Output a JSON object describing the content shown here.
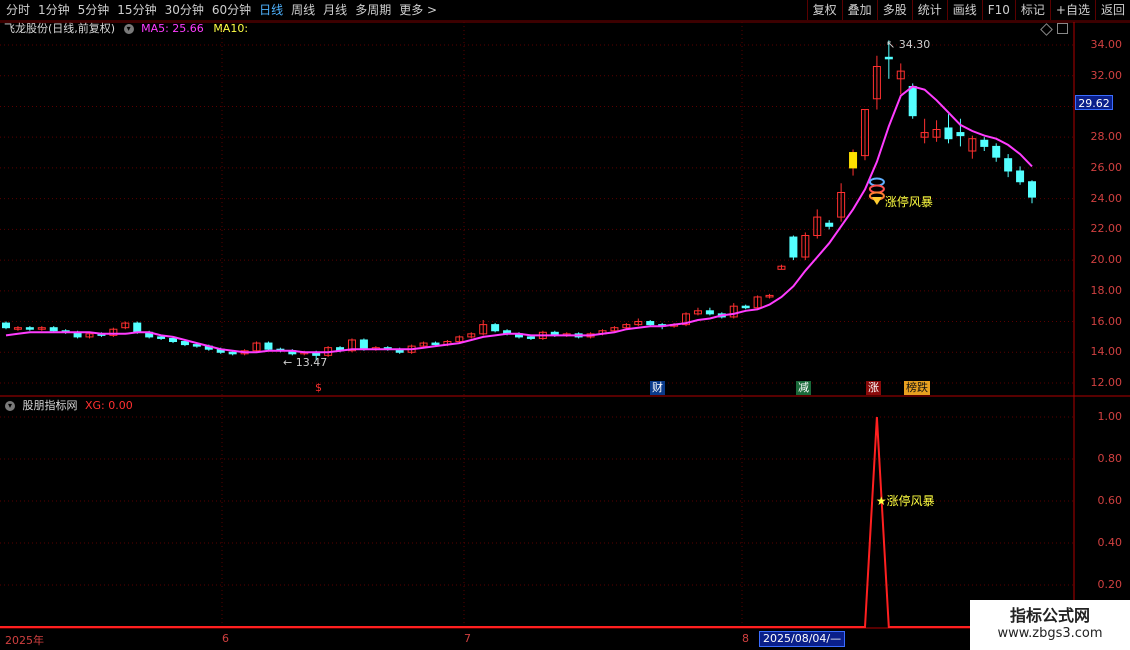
{
  "toolbar": {
    "periods": [
      "分时",
      "1分钟",
      "5分钟",
      "15分钟",
      "30分钟",
      "60分钟",
      "日线",
      "周线",
      "月线",
      "多周期",
      "更多 >"
    ],
    "active_period": "日线",
    "actions": [
      "复权",
      "叠加",
      "多股",
      "统计",
      "画线",
      "F10",
      "标记",
      "+自选",
      "返回"
    ]
  },
  "main_chart": {
    "title": "飞龙股份(日线,前复权)",
    "ma5_label": "MA5: 25.66",
    "ma10_label": "MA10:",
    "current_price_tag": "29.62",
    "high_annotation": "34.30",
    "low_annotation": "13.47",
    "signal_label": "涨停风暴",
    "y_ticks": [
      "34.00",
      "32.00",
      "28.00",
      "26.00",
      "24.00",
      "22.00",
      "20.00",
      "18.00",
      "16.00",
      "14.00",
      "12.00"
    ],
    "events": {
      "s": "$",
      "cai": "财",
      "jian": "减",
      "zhang": "涨",
      "bang": "榜跌"
    }
  },
  "sub_chart": {
    "title": "股朋指标网",
    "xg_label": "XG: 0.00",
    "signal_label": "★涨停风暴",
    "y_ticks": [
      "1.00",
      "0.80",
      "0.60",
      "0.40",
      "0.20"
    ]
  },
  "date_axis": {
    "labels": [
      "2025年",
      "6",
      "7",
      "8"
    ],
    "selected": "2025/08/04/—"
  },
  "watermark": {
    "line1": "指标公式网",
    "line2": "www.zbgs3.com"
  },
  "colors": {
    "up": "#ff3030",
    "down": "#54ffff",
    "ma5": "#ff3cff",
    "grid": "#5a0000",
    "signal": "#ffff40",
    "limit_up_bar": "#ffe000"
  },
  "chart_data": {
    "type": "candlestick",
    "title": "飞龙股份(日线,前复权)",
    "ylim": [
      11.5,
      35
    ],
    "candles": [
      [
        15.9,
        15.6,
        16.0,
        15.5
      ],
      [
        15.5,
        15.6,
        15.7,
        15.4
      ],
      [
        15.6,
        15.5,
        15.7,
        15.4
      ],
      [
        15.5,
        15.6,
        15.7,
        15.4
      ],
      [
        15.6,
        15.4,
        15.7,
        15.3
      ],
      [
        15.4,
        15.3,
        15.5,
        15.2
      ],
      [
        15.3,
        15.0,
        15.4,
        14.9
      ],
      [
        15.0,
        15.2,
        15.3,
        14.9
      ],
      [
        15.2,
        15.1,
        15.3,
        15.0
      ],
      [
        15.1,
        15.5,
        15.6,
        15.0
      ],
      [
        15.6,
        15.9,
        16.0,
        15.5
      ],
      [
        15.9,
        15.3,
        16.0,
        15.2
      ],
      [
        15.3,
        15.0,
        15.4,
        14.9
      ],
      [
        15.0,
        14.9,
        15.1,
        14.8
      ],
      [
        14.9,
        14.7,
        15.0,
        14.6
      ],
      [
        14.7,
        14.5,
        14.8,
        14.4
      ],
      [
        14.5,
        14.4,
        14.6,
        14.3
      ],
      [
        14.4,
        14.2,
        14.5,
        14.1
      ],
      [
        14.2,
        14.0,
        14.3,
        13.9
      ],
      [
        14.0,
        13.9,
        14.1,
        13.8
      ],
      [
        13.9,
        14.1,
        14.2,
        13.8
      ],
      [
        14.1,
        14.6,
        14.7,
        14.0
      ],
      [
        14.6,
        14.2,
        14.7,
        14.1
      ],
      [
        14.2,
        14.1,
        14.3,
        14.0
      ],
      [
        14.1,
        13.9,
        14.2,
        13.8
      ],
      [
        13.9,
        14.0,
        14.1,
        13.8
      ],
      [
        14.0,
        13.8,
        14.1,
        13.47
      ],
      [
        13.8,
        14.3,
        14.4,
        13.7
      ],
      [
        14.3,
        14.1,
        14.4,
        14.0
      ],
      [
        14.1,
        14.8,
        14.9,
        14.0
      ],
      [
        14.8,
        14.2,
        14.9,
        14.1
      ],
      [
        14.2,
        14.3,
        14.4,
        14.1
      ],
      [
        14.3,
        14.2,
        14.4,
        14.1
      ],
      [
        14.2,
        14.0,
        14.3,
        13.9
      ],
      [
        14.0,
        14.4,
        14.5,
        13.9
      ],
      [
        14.4,
        14.6,
        14.7,
        14.3
      ],
      [
        14.6,
        14.5,
        14.7,
        14.4
      ],
      [
        14.5,
        14.7,
        14.8,
        14.4
      ],
      [
        14.7,
        15.0,
        15.1,
        14.6
      ],
      [
        15.0,
        15.2,
        15.3,
        14.9
      ],
      [
        15.2,
        15.8,
        16.1,
        15.1
      ],
      [
        15.8,
        15.4,
        15.9,
        15.3
      ],
      [
        15.4,
        15.2,
        15.5,
        15.1
      ],
      [
        15.2,
        15.0,
        15.3,
        14.9
      ],
      [
        15.0,
        14.9,
        15.1,
        14.8
      ],
      [
        14.9,
        15.3,
        15.4,
        14.8
      ],
      [
        15.3,
        15.1,
        15.4,
        15.0
      ],
      [
        15.1,
        15.2,
        15.3,
        15.0
      ],
      [
        15.2,
        15.0,
        15.3,
        14.9
      ],
      [
        15.0,
        15.2,
        15.3,
        14.9
      ],
      [
        15.2,
        15.4,
        15.5,
        15.1
      ],
      [
        15.4,
        15.6,
        15.7,
        15.3
      ],
      [
        15.6,
        15.8,
        15.9,
        15.5
      ],
      [
        15.8,
        16.0,
        16.2,
        15.7
      ],
      [
        16.0,
        15.8,
        16.1,
        15.7
      ],
      [
        15.8,
        15.7,
        15.9,
        15.5
      ],
      [
        15.7,
        15.8,
        15.9,
        15.6
      ],
      [
        15.8,
        16.5,
        16.6,
        15.7
      ],
      [
        16.5,
        16.7,
        16.9,
        16.4
      ],
      [
        16.7,
        16.5,
        16.9,
        16.4
      ],
      [
        16.5,
        16.3,
        16.6,
        16.2
      ],
      [
        16.3,
        17.0,
        17.2,
        16.2
      ],
      [
        17.0,
        16.9,
        17.1,
        16.8
      ],
      [
        16.9,
        17.6,
        17.7,
        16.8
      ],
      [
        17.6,
        17.7,
        17.8,
        17.5
      ],
      [
        19.4,
        19.6,
        19.7,
        19.4
      ],
      [
        21.5,
        20.2,
        21.6,
        20.0
      ],
      [
        20.2,
        21.6,
        21.8,
        20.0
      ],
      [
        21.6,
        22.8,
        23.3,
        21.4
      ],
      [
        22.4,
        22.2,
        22.6,
        22.0
      ],
      [
        22.8,
        24.4,
        25.0,
        22.5
      ],
      [
        26.0,
        27.0,
        27.2,
        25.5
      ],
      [
        26.8,
        29.8,
        29.8,
        26.5
      ],
      [
        30.5,
        32.6,
        33.3,
        29.8
      ],
      [
        33.2,
        33.1,
        34.3,
        31.8
      ],
      [
        31.8,
        32.3,
        32.8,
        30.8
      ],
      [
        31.3,
        29.4,
        31.5,
        29.2
      ],
      [
        28.0,
        28.3,
        29.2,
        27.6
      ],
      [
        28.0,
        28.5,
        29.1,
        27.7
      ],
      [
        28.6,
        27.9,
        29.5,
        27.6
      ],
      [
        28.3,
        28.1,
        29.2,
        27.4
      ],
      [
        27.1,
        27.9,
        28.1,
        26.6
      ],
      [
        27.8,
        27.4,
        28.0,
        27.1
      ],
      [
        27.4,
        26.7,
        27.6,
        26.4
      ],
      [
        26.6,
        25.8,
        26.9,
        25.4
      ],
      [
        25.8,
        25.1,
        26.1,
        24.9
      ],
      [
        25.1,
        24.1,
        25.2,
        23.7
      ]
    ],
    "ma5": [
      15.1,
      15.2,
      15.3,
      15.3,
      15.3,
      15.3,
      15.3,
      15.3,
      15.2,
      15.2,
      15.2,
      15.3,
      15.3,
      15.1,
      15.0,
      14.8,
      14.6,
      14.4,
      14.2,
      14.1,
      14.0,
      14.0,
      14.1,
      14.1,
      14.1,
      14.0,
      14.0,
      14.0,
      14.1,
      14.2,
      14.2,
      14.2,
      14.2,
      14.2,
      14.2,
      14.3,
      14.4,
      14.5,
      14.6,
      14.8,
      15.0,
      15.1,
      15.2,
      15.2,
      15.1,
      15.1,
      15.1,
      15.1,
      15.1,
      15.1,
      15.2,
      15.3,
      15.5,
      15.6,
      15.7,
      15.7,
      15.8,
      15.9,
      16.1,
      16.2,
      16.4,
      16.5,
      16.7,
      16.8,
      17.1,
      17.6,
      18.3,
      19.3,
      20.2,
      21.1,
      22.2,
      23.3,
      24.6,
      26.4,
      28.7,
      30.7,
      31.3,
      31.1,
      30.4,
      29.6,
      28.8,
      28.4,
      28.1,
      27.9,
      27.5,
      26.9,
      26.1
    ]
  },
  "sub_chart_data": {
    "type": "line",
    "ylim": [
      0,
      1.05
    ],
    "spike_index": 73,
    "values_note_index_only": true
  }
}
